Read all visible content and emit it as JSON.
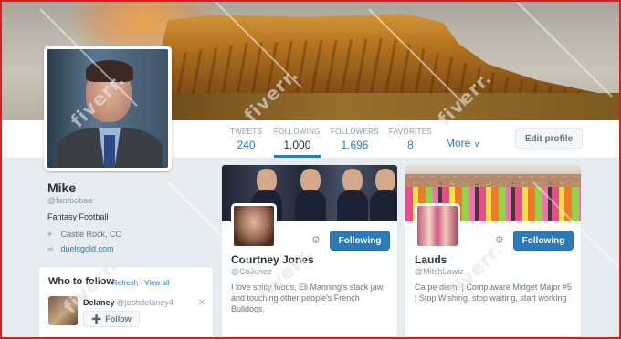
{
  "profile": {
    "name": "Mike",
    "handle": "@fanfoobaa",
    "bio": "Fantasy Football",
    "location": "Castle Rock, CO",
    "website": "duelsgold.com"
  },
  "nav": {
    "stats": [
      {
        "label": "TWEETS",
        "value": "240"
      },
      {
        "label": "FOLLOWING",
        "value": "1,000"
      },
      {
        "label": "FOLLOWERS",
        "value": "1,696"
      },
      {
        "label": "FAVORITES",
        "value": "8"
      }
    ],
    "more_label": "More",
    "edit_label": "Edit profile"
  },
  "who_to_follow": {
    "title": "Who to follow",
    "refresh_label": "Refresh",
    "separator": " · ",
    "view_all_label": "View all",
    "suggestions": [
      {
        "name": "Delaney",
        "handle": "@joshdelaney4",
        "follow_label": "Follow"
      }
    ]
  },
  "cards": [
    {
      "name": "Courtney Jones",
      "handle": "@CoJonez",
      "bio": "I love spicy foods, Eli Manning's slack jaw, and touching other people's French Bulldogs.",
      "button_label": "Following"
    },
    {
      "name": "Lauds",
      "handle": "@MitchLawlz",
      "bio": "Carpe diem! | Compuware Midget Major #5 | Stop Wishing, stop waiting, start working",
      "button_label": "Following"
    }
  ],
  "watermark_text": "fiverr.",
  "colors": {
    "link": "#2b7bb9",
    "follow_button": "#2b7bb9",
    "page_bg": "#e6ecf0",
    "frame_border": "#d62020"
  },
  "icons": {
    "location": "map-pin-icon",
    "website": "link-icon",
    "more": "chevron-down-icon",
    "settings": "gear-icon",
    "close": "close-icon",
    "follow": "person-add-icon"
  }
}
